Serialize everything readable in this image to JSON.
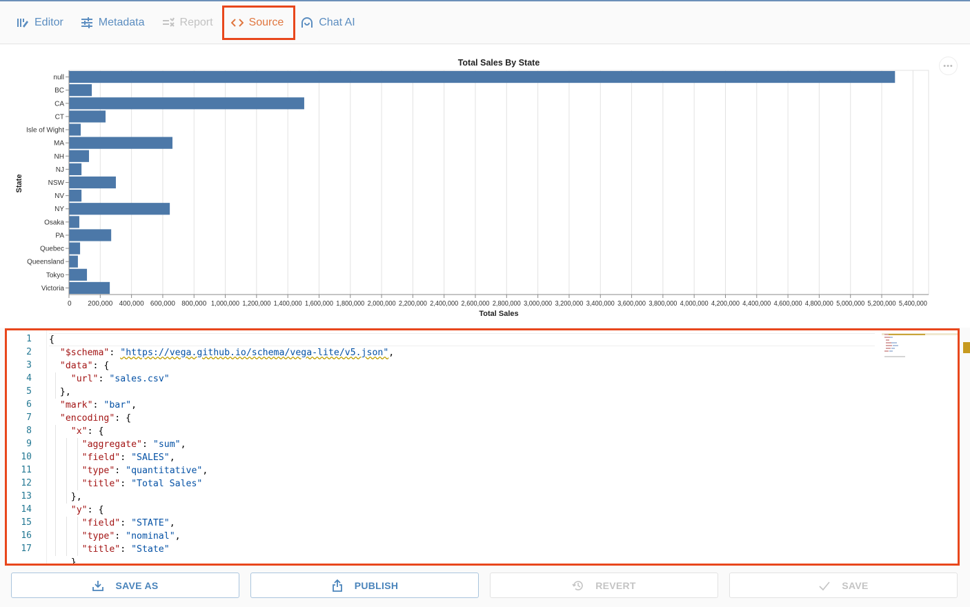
{
  "toolbar": {
    "tabs": [
      {
        "label": "Editor",
        "icon": "editor-icon",
        "state": "normal"
      },
      {
        "label": "Metadata",
        "icon": "sliders-icon",
        "state": "normal"
      },
      {
        "label": "Report",
        "icon": "report-icon",
        "state": "disabled"
      },
      {
        "label": "Source",
        "icon": "code-icon",
        "state": "active"
      },
      {
        "label": "Chat AI",
        "icon": "chat-ai-icon",
        "state": "normal"
      }
    ]
  },
  "chart_menu": {
    "icon": "more-icon",
    "label": "•••"
  },
  "chart_data": {
    "type": "bar",
    "orientation": "horizontal",
    "title": "Total Sales By State",
    "xlabel": "Total Sales",
    "ylabel": "State",
    "categories": [
      "null",
      "BC",
      "CA",
      "CT",
      "Isle of Wight",
      "MA",
      "NH",
      "NJ",
      "NSW",
      "NV",
      "NY",
      "Osaka",
      "PA",
      "Quebec",
      "Queensland",
      "Tokyo",
      "Victoria"
    ],
    "values": [
      5285000,
      146000,
      1505000,
      234000,
      75000,
      662000,
      128000,
      80000,
      300000,
      80000,
      645000,
      66000,
      270000,
      71000,
      57000,
      115000,
      261000
    ],
    "xlim": [
      0,
      5500000
    ],
    "x_ticks": [
      0,
      200000,
      400000,
      600000,
      800000,
      1000000,
      1200000,
      1400000,
      1600000,
      1800000,
      2000000,
      2200000,
      2400000,
      2600000,
      2800000,
      3000000,
      3200000,
      3400000,
      3600000,
      3800000,
      4000000,
      4200000,
      4400000,
      4600000,
      4800000,
      5000000,
      5200000,
      5400000
    ],
    "x_tick_labels": [
      "0",
      "200,000",
      "400,000",
      "600,000",
      "800,000",
      "1,000,000",
      "1,200,000",
      "1,400,000",
      "1,600,000",
      "1,800,000",
      "2,000,000",
      "2,200,000",
      "2,400,000",
      "2,600,000",
      "2,800,000",
      "3,000,000",
      "3,200,000",
      "3,400,000",
      "3,600,000",
      "3,800,000",
      "4,000,000",
      "4,200,000",
      "4,400,000",
      "4,600,000",
      "4,800,000",
      "5,000,000",
      "5,200,000",
      "5,400,000"
    ],
    "grid": true,
    "bar_color": "#4c78a8"
  },
  "editor": {
    "line_numbers": [
      "1",
      "2",
      "3",
      "4",
      "5",
      "6",
      "7",
      "8",
      "9",
      "10",
      "11",
      "12",
      "13",
      "14",
      "15",
      "16",
      "17"
    ],
    "lines": [
      [
        {
          "t": "p",
          "v": "{"
        }
      ],
      [
        {
          "t": "p",
          "v": "  "
        },
        {
          "t": "k",
          "v": "\"$schema\""
        },
        {
          "t": "p",
          "v": ": "
        },
        {
          "t": "u",
          "v": "\"https://vega.github.io/schema/vega-lite/v5.json\""
        },
        {
          "t": "p",
          "v": ","
        }
      ],
      [
        {
          "t": "p",
          "v": "  "
        },
        {
          "t": "k",
          "v": "\"data\""
        },
        {
          "t": "p",
          "v": ": {"
        }
      ],
      [
        {
          "t": "p",
          "v": "    "
        },
        {
          "t": "k",
          "v": "\"url\""
        },
        {
          "t": "p",
          "v": ": "
        },
        {
          "t": "s",
          "v": "\"sales.csv\""
        }
      ],
      [
        {
          "t": "p",
          "v": "  },"
        }
      ],
      [
        {
          "t": "p",
          "v": "  "
        },
        {
          "t": "k",
          "v": "\"mark\""
        },
        {
          "t": "p",
          "v": ": "
        },
        {
          "t": "s",
          "v": "\"bar\""
        },
        {
          "t": "p",
          "v": ","
        }
      ],
      [
        {
          "t": "p",
          "v": "  "
        },
        {
          "t": "k",
          "v": "\"encoding\""
        },
        {
          "t": "p",
          "v": ": {"
        }
      ],
      [
        {
          "t": "p",
          "v": "    "
        },
        {
          "t": "k",
          "v": "\"x\""
        },
        {
          "t": "p",
          "v": ": {"
        }
      ],
      [
        {
          "t": "p",
          "v": "      "
        },
        {
          "t": "k",
          "v": "\"aggregate\""
        },
        {
          "t": "p",
          "v": ": "
        },
        {
          "t": "s",
          "v": "\"sum\""
        },
        {
          "t": "p",
          "v": ","
        }
      ],
      [
        {
          "t": "p",
          "v": "      "
        },
        {
          "t": "k",
          "v": "\"field\""
        },
        {
          "t": "p",
          "v": ": "
        },
        {
          "t": "s",
          "v": "\"SALES\""
        },
        {
          "t": "p",
          "v": ","
        }
      ],
      [
        {
          "t": "p",
          "v": "      "
        },
        {
          "t": "k",
          "v": "\"type\""
        },
        {
          "t": "p",
          "v": ": "
        },
        {
          "t": "s",
          "v": "\"quantitative\""
        },
        {
          "t": "p",
          "v": ","
        }
      ],
      [
        {
          "t": "p",
          "v": "      "
        },
        {
          "t": "k",
          "v": "\"title\""
        },
        {
          "t": "p",
          "v": ": "
        },
        {
          "t": "s",
          "v": "\"Total Sales\""
        }
      ],
      [
        {
          "t": "p",
          "v": "    },"
        }
      ],
      [
        {
          "t": "p",
          "v": "    "
        },
        {
          "t": "k",
          "v": "\"y\""
        },
        {
          "t": "p",
          "v": ": {"
        }
      ],
      [
        {
          "t": "p",
          "v": "      "
        },
        {
          "t": "k",
          "v": "\"field\""
        },
        {
          "t": "p",
          "v": ": "
        },
        {
          "t": "s",
          "v": "\"STATE\""
        },
        {
          "t": "p",
          "v": ","
        }
      ],
      [
        {
          "t": "p",
          "v": "      "
        },
        {
          "t": "k",
          "v": "\"type\""
        },
        {
          "t": "p",
          "v": ": "
        },
        {
          "t": "s",
          "v": "\"nominal\""
        },
        {
          "t": "p",
          "v": ","
        }
      ],
      [
        {
          "t": "p",
          "v": "      "
        },
        {
          "t": "k",
          "v": "\"title\""
        },
        {
          "t": "p",
          "v": ": "
        },
        {
          "t": "s",
          "v": "\"State\""
        }
      ]
    ]
  },
  "actions": {
    "save_as": {
      "label": "SAVE AS",
      "icon": "download-icon",
      "enabled": true
    },
    "publish": {
      "label": "PUBLISH",
      "icon": "share-icon",
      "enabled": true
    },
    "revert": {
      "label": "REVERT",
      "icon": "history-icon",
      "enabled": false
    },
    "save": {
      "label": "SAVE",
      "icon": "check-icon",
      "enabled": false
    }
  }
}
